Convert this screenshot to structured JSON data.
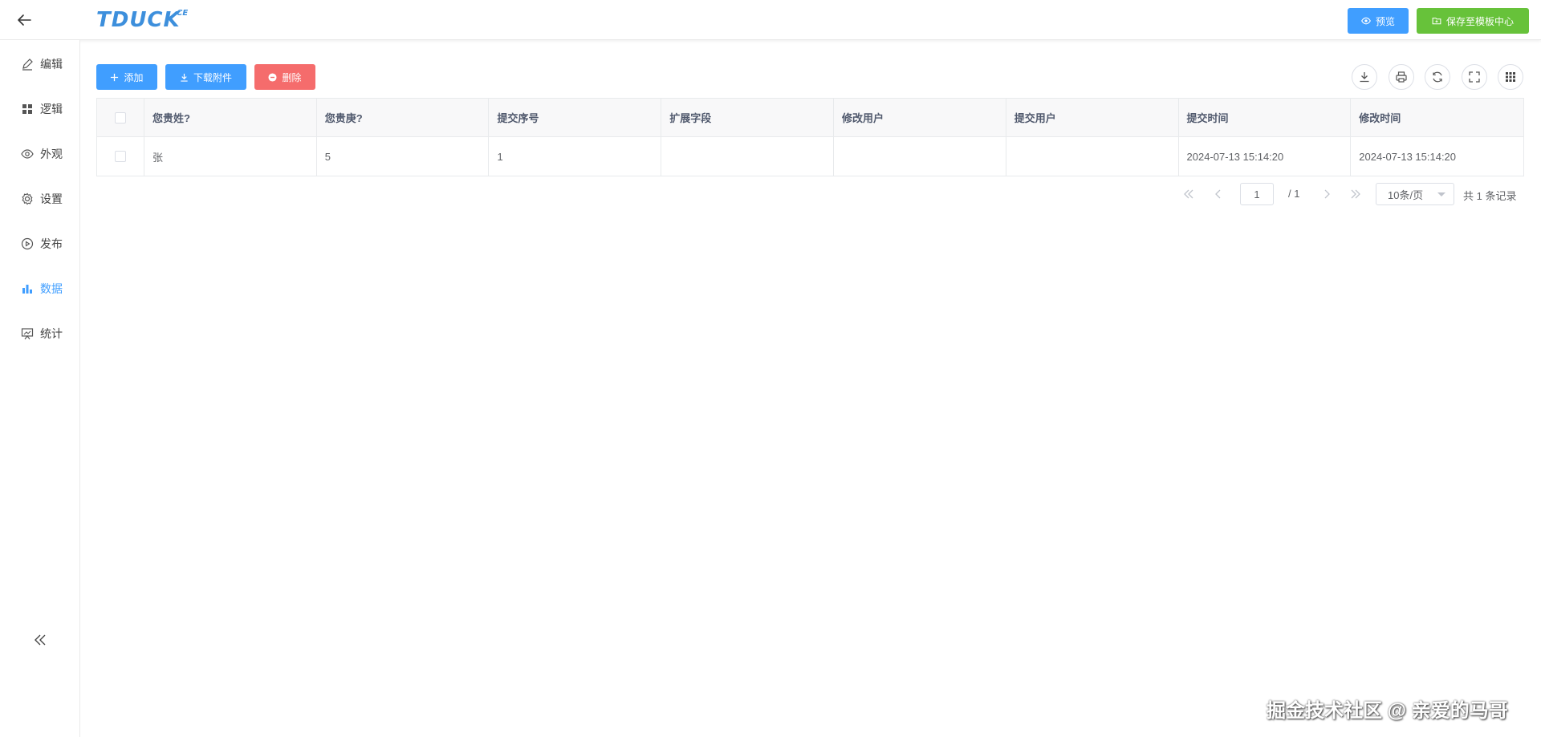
{
  "header": {
    "logo_text": "TDUCK",
    "logo_sup": "CE",
    "preview_label": "预览",
    "save_template_label": "保存至模板中心"
  },
  "sidebar": {
    "items": [
      {
        "label": "编辑",
        "icon": "edit-icon"
      },
      {
        "label": "逻辑",
        "icon": "grid-icon"
      },
      {
        "label": "外观",
        "icon": "eye-icon"
      },
      {
        "label": "设置",
        "icon": "gear-icon"
      },
      {
        "label": "发布",
        "icon": "play-icon"
      },
      {
        "label": "数据",
        "icon": "bar-chart-icon",
        "active": true
      },
      {
        "label": "统计",
        "icon": "presentation-icon"
      }
    ]
  },
  "toolbar": {
    "add_label": "添加",
    "download_label": "下载附件",
    "delete_label": "删除"
  },
  "table": {
    "columns": [
      "您贵姓?",
      "您贵庚?",
      "提交序号",
      "扩展字段",
      "修改用户",
      "提交用户",
      "提交时间",
      "修改时间"
    ],
    "rows": [
      [
        "张",
        "5",
        "1",
        "",
        "",
        "",
        "2024-07-13 15:14:20",
        "2024-07-13 15:14:20"
      ]
    ]
  },
  "pagination": {
    "current_page": "1",
    "total_pages": "/ 1",
    "page_size": "10条/页",
    "total_records": "共 1 条记录"
  },
  "watermark": "掘金技术社区 @ 亲爱的马哥",
  "colors": {
    "primary": "#409eff",
    "success": "#67c23a",
    "danger": "#f56c6c",
    "logo": "#3d8fdc"
  }
}
